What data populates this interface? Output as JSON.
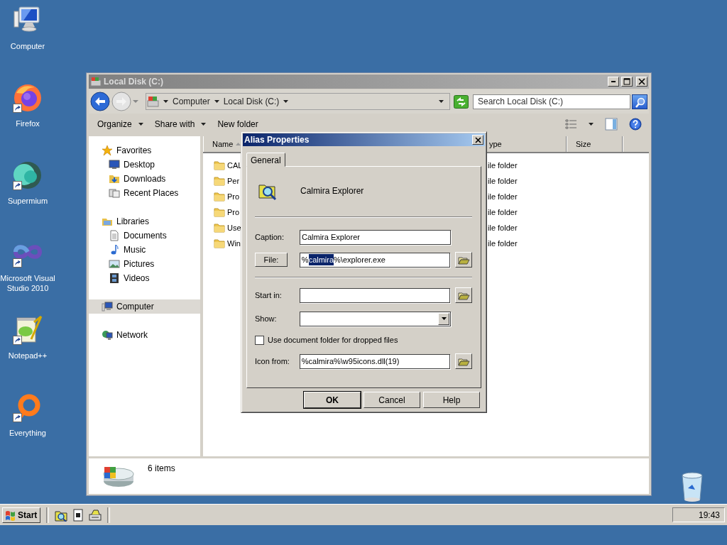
{
  "desktop_icons": [
    {
      "label": "Computer",
      "shortcut": false
    },
    {
      "label": "Firefox",
      "shortcut": true
    },
    {
      "label": "Supermium",
      "shortcut": true
    },
    {
      "label": "Microsoft Visual Studio 2010",
      "shortcut": true
    },
    {
      "label": "Notepad++",
      "shortcut": true
    },
    {
      "label": "Everything",
      "shortcut": true
    }
  ],
  "explorer": {
    "title": "Local Disk (C:)",
    "breadcrumb": [
      "Computer",
      "Local Disk (C:)"
    ],
    "search": {
      "placeholder": "Search Local Disk (C:)"
    },
    "toolbar": [
      {
        "label": "Organize",
        "dropdown": true
      },
      {
        "label": "Share with",
        "dropdown": true
      },
      {
        "label": "New folder",
        "dropdown": false
      }
    ],
    "sidebar": [
      {
        "label": "Favorites",
        "selected": false,
        "children": [
          {
            "label": "Desktop",
            "selected": false
          },
          {
            "label": "Downloads",
            "selected": false
          },
          {
            "label": "Recent Places",
            "selected": false
          }
        ]
      },
      {
        "label": "Libraries",
        "selected": false,
        "children": [
          {
            "label": "Documents",
            "selected": false
          },
          {
            "label": "Music",
            "selected": false
          },
          {
            "label": "Pictures",
            "selected": false
          },
          {
            "label": "Videos",
            "selected": false
          }
        ]
      },
      {
        "label": "Computer",
        "selected": true
      },
      {
        "label": "Network",
        "selected": false
      }
    ],
    "columns": [
      {
        "label": "Name",
        "sorted": true
      },
      {
        "label": "ype",
        "sorted": false
      },
      {
        "label": "Size",
        "sorted": false
      }
    ],
    "rows": [
      {
        "name": "CAL",
        "type": "ile folder"
      },
      {
        "name": "Per",
        "type": "ile folder"
      },
      {
        "name": "Pro",
        "type": "ile folder"
      },
      {
        "name": "Pro",
        "type": "ile folder"
      },
      {
        "name": "Use",
        "type": "ile folder"
      },
      {
        "name": "Win",
        "type": "ile folder"
      }
    ],
    "status": "6 items"
  },
  "dialog": {
    "title": "Alias Properties",
    "tabs": [
      {
        "label": "General",
        "selected": true
      }
    ],
    "heading": "Calmira Explorer",
    "caption": {
      "label": "Caption:",
      "value": "Calmira Explorer"
    },
    "file": {
      "label": "File:",
      "value_before": "%",
      "value_selected": "calmira",
      "value_after": "%\\explorer.exe"
    },
    "start_in": {
      "label": "Start in:"
    },
    "show": {
      "label": "Show:"
    },
    "checkbox": {
      "label": "Use document folder for dropped files",
      "checked": false
    },
    "icon_from": {
      "label": "Icon from:",
      "value": "%calmira%\\w95icons.dll(19)"
    },
    "buttons": [
      {
        "label": "OK",
        "default": true
      },
      {
        "label": "Cancel",
        "default": false
      },
      {
        "label": "Help",
        "default": false
      }
    ]
  },
  "taskbar": {
    "start": "Start",
    "clock": "19:43"
  }
}
